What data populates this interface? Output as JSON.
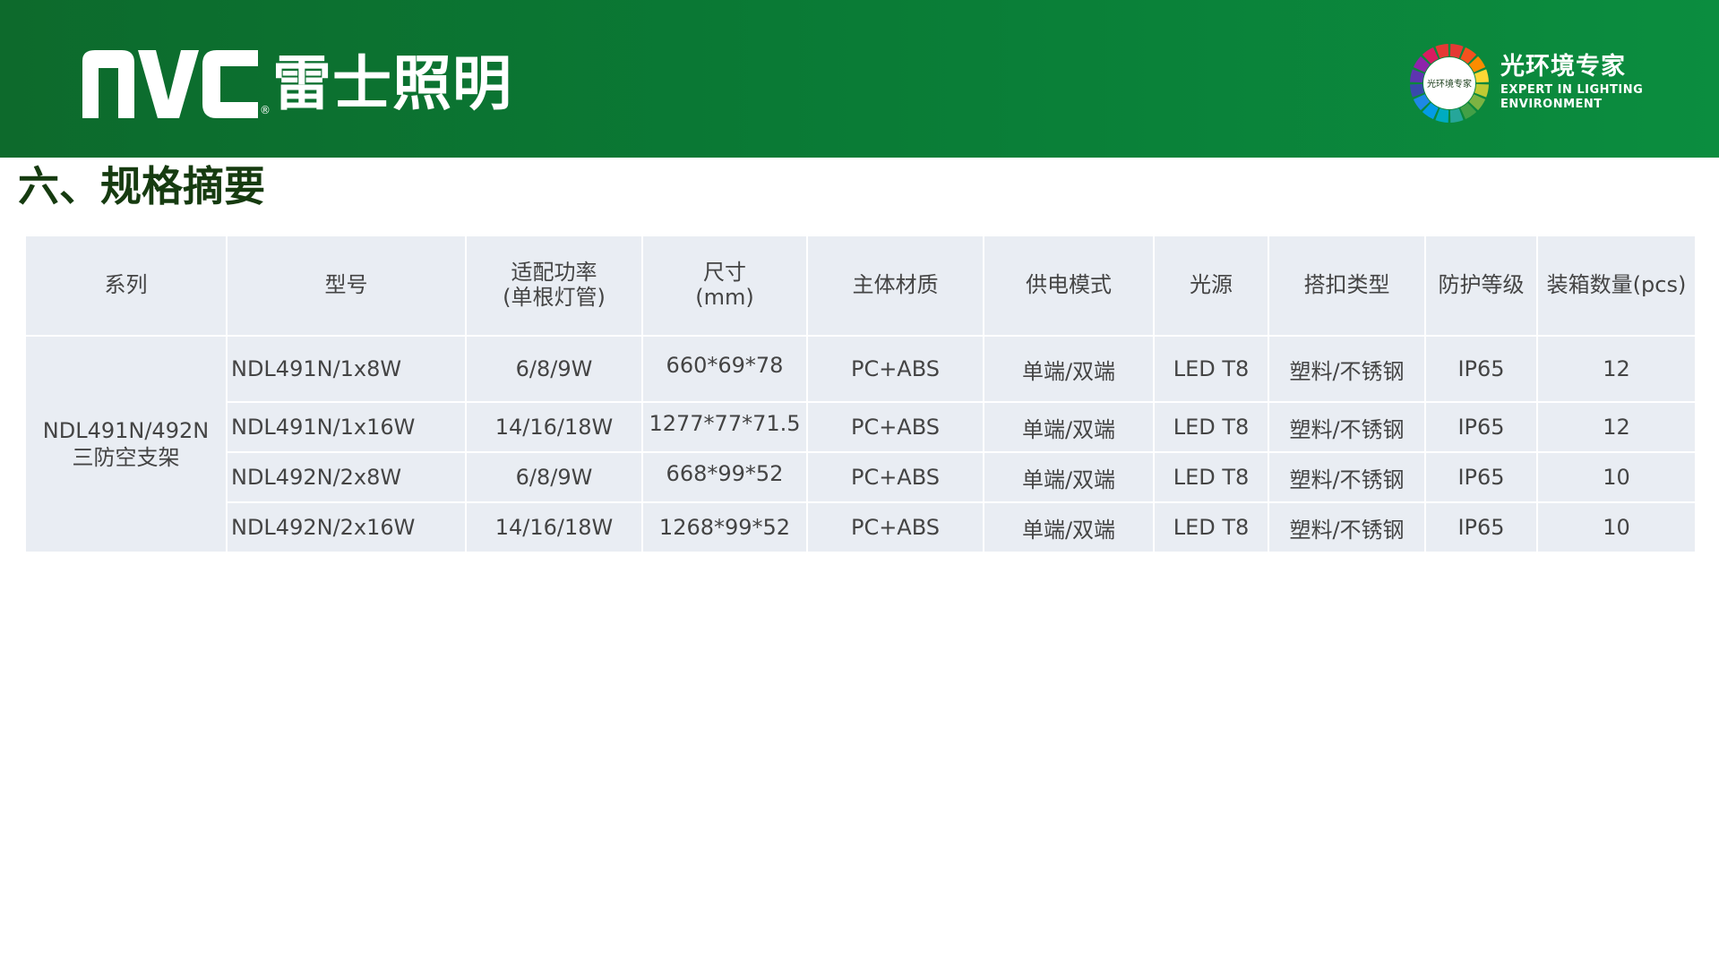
{
  "header": {
    "brand_logo_text": "nVc",
    "brand_registered": "®",
    "brand_cn": "雷士照明",
    "expert_badge_text": "光环境专家",
    "expert_cn": "光环境专家",
    "expert_en_line1": "EXPERT IN LIGHTING",
    "expert_en_line2": "ENVIRONMENT"
  },
  "page_title": "六、规格摘要",
  "table": {
    "headers": {
      "series": "系列",
      "model": "型号",
      "power_line1": "适配功率",
      "power_line2": "(单根灯管)",
      "size_line1": "尺寸",
      "size_line2": "(mm)",
      "material": "主体材质",
      "supply": "供电模式",
      "source": "光源",
      "clip": "搭扣类型",
      "ip": "防护等级",
      "qty": "装箱数量(pcs)"
    },
    "series_line1": "NDL491N/492N",
    "series_line2": "三防空支架",
    "rows": [
      {
        "model": "NDL491N/1x8W",
        "power": "6/8/9W",
        "size": "660*69*78",
        "material": "PC+ABS",
        "supply": "单端/双端",
        "source": "LED T8",
        "clip": "塑料/不锈钢",
        "ip": "IP65",
        "qty": "12"
      },
      {
        "model": "NDL491N/1x16W",
        "power": "14/16/18W",
        "size": "1277*77*71.5",
        "material": "PC+ABS",
        "supply": "单端/双端",
        "source": "LED T8",
        "clip": "塑料/不锈钢",
        "ip": "IP65",
        "qty": "12"
      },
      {
        "model": "NDL492N/2x8W",
        "power": "6/8/9W",
        "size": "668*99*52",
        "material": "PC+ABS",
        "supply": "单端/双端",
        "source": "LED T8",
        "clip": "塑料/不锈钢",
        "ip": "IP65",
        "qty": "10"
      },
      {
        "model": "NDL492N/2x16W",
        "power": "14/16/18W",
        "size": "1268*99*52",
        "material": "PC+ABS",
        "supply": "单端/双端",
        "source": "LED T8",
        "clip": "塑料/不锈钢",
        "ip": "IP65",
        "qty": "10"
      }
    ]
  },
  "colors": {
    "header_dark": "#0d6a2c",
    "header_light": "#0b8d3f",
    "title": "#163b10",
    "cell_bg": "#e9edf3",
    "cell_text": "#444444"
  }
}
